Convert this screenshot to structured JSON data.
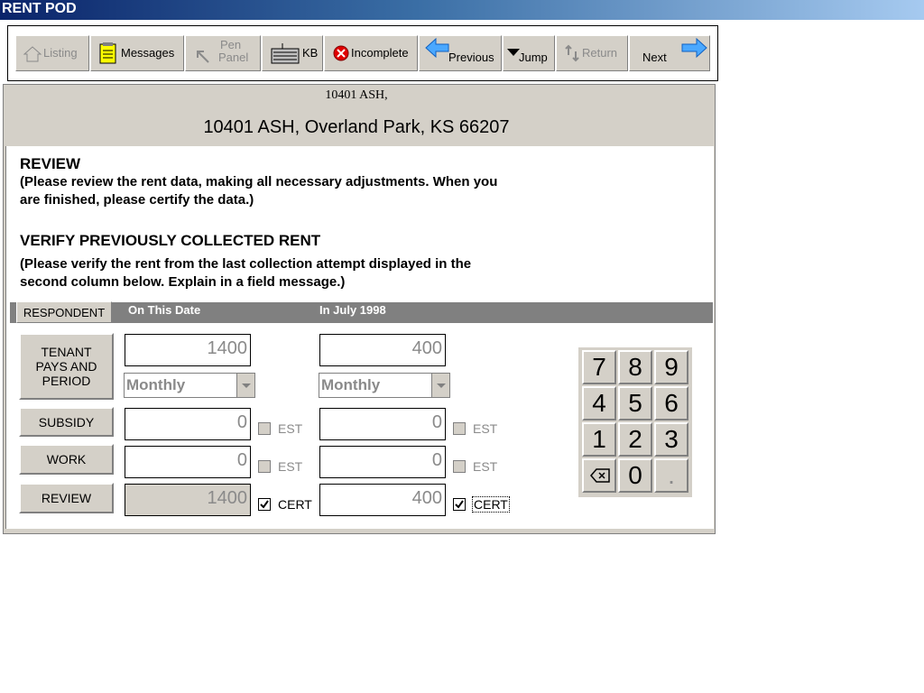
{
  "window": {
    "title": "RENT POD"
  },
  "toolbar": {
    "listing": "Listing",
    "messages": "Messages",
    "pen_panel_line1": "Pen",
    "pen_panel_line2": "Panel",
    "kb": "KB",
    "incomplete": "Incomplete",
    "previous": "Previous",
    "jump": "Jump",
    "return": "Return",
    "next": "Next"
  },
  "header": {
    "address_short": "10401 ASH,",
    "address_full": "10401 ASH,  Overland Park, KS 66207"
  },
  "review": {
    "title": "REVIEW",
    "line1": "(Please review the rent data, making all necessary adjustments. When you",
    "line2": "are finished, please certify the data.)"
  },
  "verify": {
    "title": "VERIFY PREVIOUSLY COLLECTED RENT",
    "line1": "(Please verify the rent from the last collection attempt displayed in the",
    "line2": "second column below. Explain in a field message.)"
  },
  "columns": {
    "respondent": "RESPONDENT",
    "col1": "On This Date",
    "col2": "In July 1998"
  },
  "rows": {
    "tenant_label": "TENANT PAYS AND PERIOD",
    "subsidy_label": "SUBSIDY",
    "work_label": "WORK",
    "review_label": "REVIEW"
  },
  "values": {
    "tenant_current": "1400",
    "tenant_previous": "400",
    "period_current": "Monthly",
    "period_previous": "Monthly",
    "subsidy_current": "0",
    "subsidy_previous": "0",
    "work_current": "0",
    "work_previous": "0",
    "review_current": "1400",
    "review_previous": "400"
  },
  "checks": {
    "est": "EST",
    "cert": "CERT",
    "cert_current_checked": true,
    "cert_previous_checked": true
  },
  "keypad": {
    "k7": "7",
    "k8": "8",
    "k9": "9",
    "k4": "4",
    "k5": "5",
    "k6": "6",
    "k1": "1",
    "k2": "2",
    "k3": "3",
    "k0": "0",
    "kdot": "."
  }
}
